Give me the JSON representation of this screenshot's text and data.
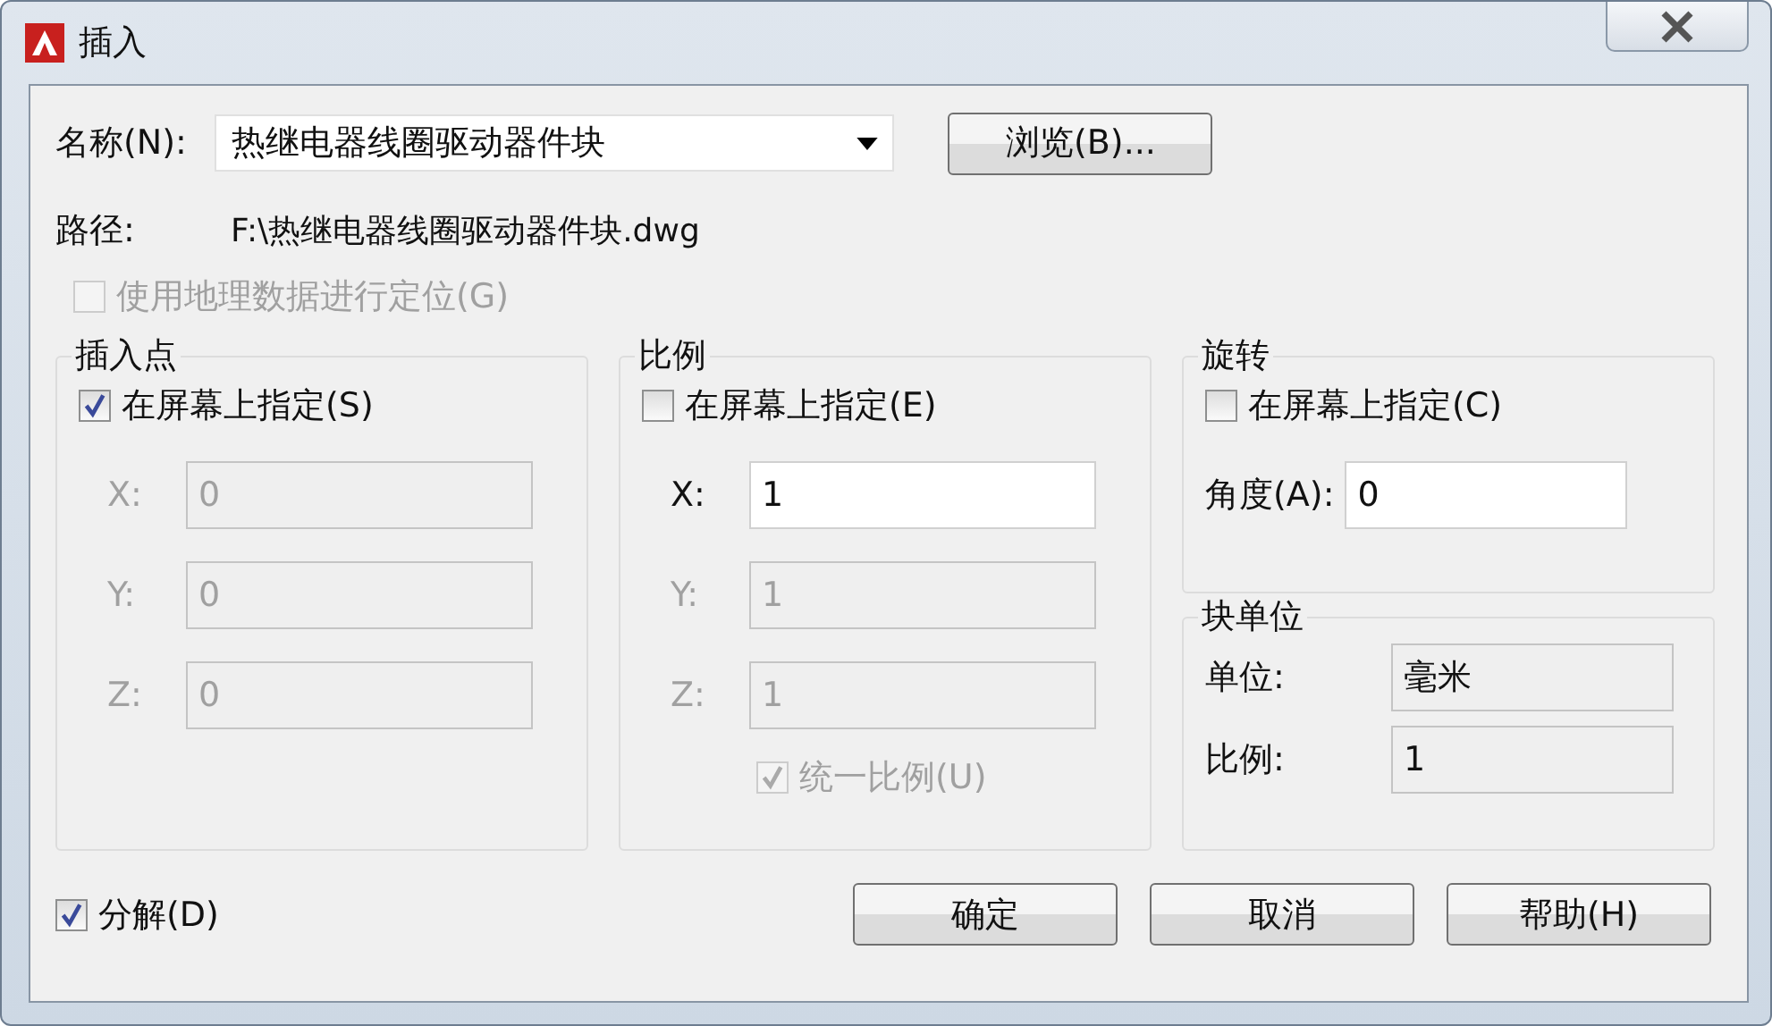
{
  "window": {
    "title": "插入"
  },
  "name": {
    "label": "名称(N):",
    "value": "热继电器线圈驱动器件块"
  },
  "browse_button": "浏览(B)...",
  "path": {
    "label": "路径:",
    "value": "F:\\热继电器线圈驱动器件块.dwg"
  },
  "geo_checkbox": {
    "label": "使用地理数据进行定位(G)",
    "checked": false,
    "disabled": true
  },
  "insertion_point": {
    "title": "插入点",
    "on_screen": {
      "label": "在屏幕上指定(S)",
      "checked": true
    },
    "fields": [
      {
        "label": "X:",
        "value": "0",
        "disabled": true
      },
      {
        "label": "Y:",
        "value": "0",
        "disabled": true
      },
      {
        "label": "Z:",
        "value": "0",
        "disabled": true
      }
    ]
  },
  "scale": {
    "title": "比例",
    "on_screen": {
      "label": "在屏幕上指定(E)",
      "checked": false
    },
    "fields": [
      {
        "label": "X:",
        "value": "1",
        "disabled": false
      },
      {
        "label": "Y:",
        "value": "1",
        "disabled": true
      },
      {
        "label": "Z:",
        "value": "1",
        "disabled": true
      }
    ],
    "uniform": {
      "label": "统一比例(U)",
      "checked": true,
      "disabled": true
    }
  },
  "rotation": {
    "title": "旋转",
    "on_screen": {
      "label": "在屏幕上指定(C)",
      "checked": false
    },
    "angle": {
      "label": "角度(A):",
      "value": "0"
    }
  },
  "block_unit": {
    "title": "块单位",
    "rows": [
      {
        "label": "单位:",
        "value": "毫米"
      },
      {
        "label": "比例:",
        "value": "1"
      }
    ]
  },
  "explode": {
    "label": "分解(D)",
    "checked": true
  },
  "buttons": [
    "确定",
    "取消",
    "帮助(H)"
  ]
}
